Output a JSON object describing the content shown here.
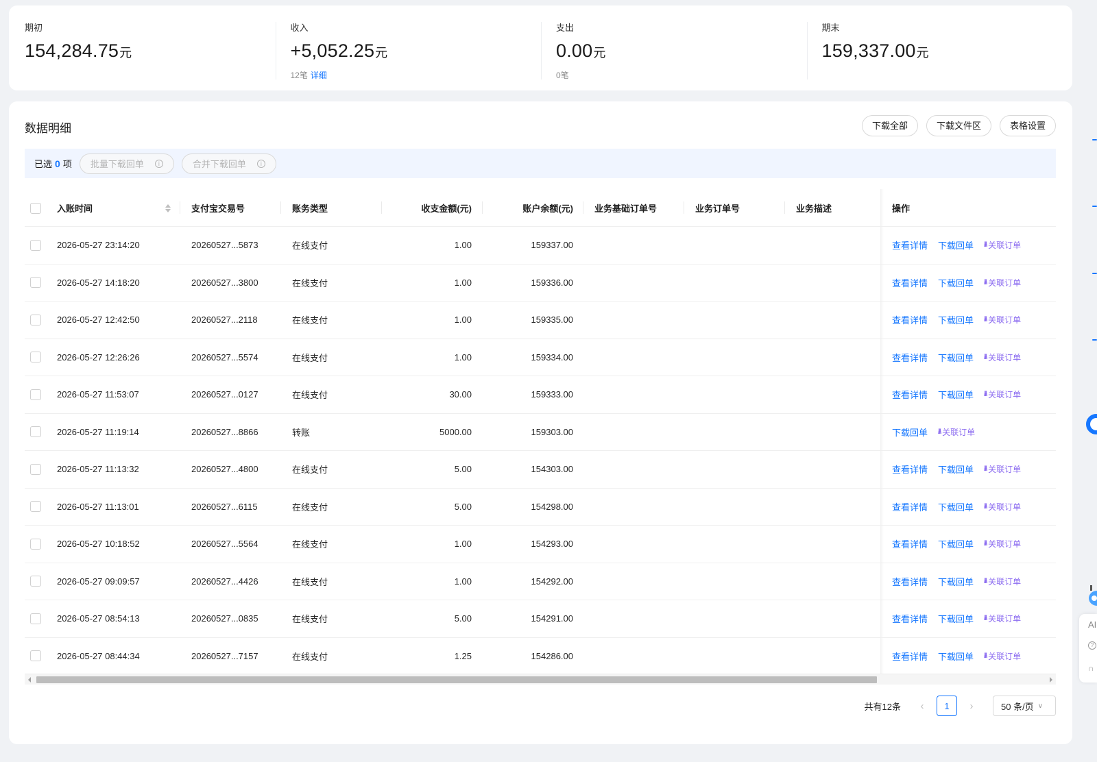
{
  "summary": [
    {
      "label": "期初",
      "value": "154,284.75",
      "unit": "元",
      "count": "",
      "detail": ""
    },
    {
      "label": "收入",
      "value": "+5,052.25",
      "unit": "元",
      "count": "12笔",
      "detail": "详细"
    },
    {
      "label": "支出",
      "value": "0.00",
      "unit": "元",
      "count": "0笔",
      "detail": ""
    },
    {
      "label": "期末",
      "value": "159,337.00",
      "unit": "元",
      "count": "",
      "detail": ""
    }
  ],
  "panel": {
    "title": "数据明细",
    "buttons": {
      "download_all": "下载全部",
      "download_area": "下载文件区",
      "table_settings": "表格设置"
    }
  },
  "selection": {
    "prefix": "已选",
    "count": "0",
    "suffix": "项",
    "batch_download": "批量下载回单",
    "merge_download": "合并下载回单",
    "info_glyph": "i"
  },
  "columns": {
    "time": "入账时间",
    "trade_no": "支付宝交易号",
    "type": "账务类型",
    "amount": "收支金额(元)",
    "balance": "账户余额(元)",
    "base_order": "业务基础订单号",
    "order": "业务订单号",
    "desc": "业务描述",
    "ops": "操作"
  },
  "actions": {
    "view": "查看详情",
    "download": "下载回单",
    "link_order": "关联订单",
    "ai_glyph": "/\\/\\"
  },
  "rows": [
    {
      "time": "2026-05-27 23:14:20",
      "trade_no": "20260527...5873",
      "type": "在线支付",
      "amount": "1.00",
      "balance": "159337.00"
    },
    {
      "time": "2026-05-27 14:18:20",
      "trade_no": "20260527...3800",
      "type": "在线支付",
      "amount": "1.00",
      "balance": "159336.00"
    },
    {
      "time": "2026-05-27 12:42:50",
      "trade_no": "20260527...2118",
      "type": "在线支付",
      "amount": "1.00",
      "balance": "159335.00"
    },
    {
      "time": "2026-05-27 12:26:26",
      "trade_no": "20260527...5574",
      "type": "在线支付",
      "amount": "1.00",
      "balance": "159334.00"
    },
    {
      "time": "2026-05-27 11:53:07",
      "trade_no": "20260527...0127",
      "type": "在线支付",
      "amount": "30.00",
      "balance": "159333.00"
    },
    {
      "time": "2026-05-27 11:19:14",
      "trade_no": "20260527...8866",
      "type": "转账",
      "amount": "5000.00",
      "balance": "159303.00"
    },
    {
      "time": "2026-05-27 11:13:32",
      "trade_no": "20260527...4800",
      "type": "在线支付",
      "amount": "5.00",
      "balance": "154303.00"
    },
    {
      "time": "2026-05-27 11:13:01",
      "trade_no": "20260527...6115",
      "type": "在线支付",
      "amount": "5.00",
      "balance": "154298.00"
    },
    {
      "time": "2026-05-27 10:18:52",
      "trade_no": "20260527...5564",
      "type": "在线支付",
      "amount": "1.00",
      "balance": "154293.00"
    },
    {
      "time": "2026-05-27 09:09:57",
      "trade_no": "20260527...4426",
      "type": "在线支付",
      "amount": "1.00",
      "balance": "154292.00"
    },
    {
      "time": "2026-05-27 08:54:13",
      "trade_no": "20260527...0835",
      "type": "在线支付",
      "amount": "5.00",
      "balance": "154291.00"
    },
    {
      "time": "2026-05-27 08:44:34",
      "trade_no": "20260527...7157",
      "type": "在线支付",
      "amount": "1.25",
      "balance": "154286.00"
    }
  ],
  "pagination": {
    "total": "共有12条",
    "prev": "‹",
    "current": "1",
    "next": "›",
    "page_size": "50 条/页",
    "caret": "∨"
  },
  "side_tools": {
    "ai": "AI",
    "help": "?",
    "support": "∩"
  },
  "colors": {
    "accent": "#1677ff",
    "ai_purple": "#8c6cf0"
  }
}
